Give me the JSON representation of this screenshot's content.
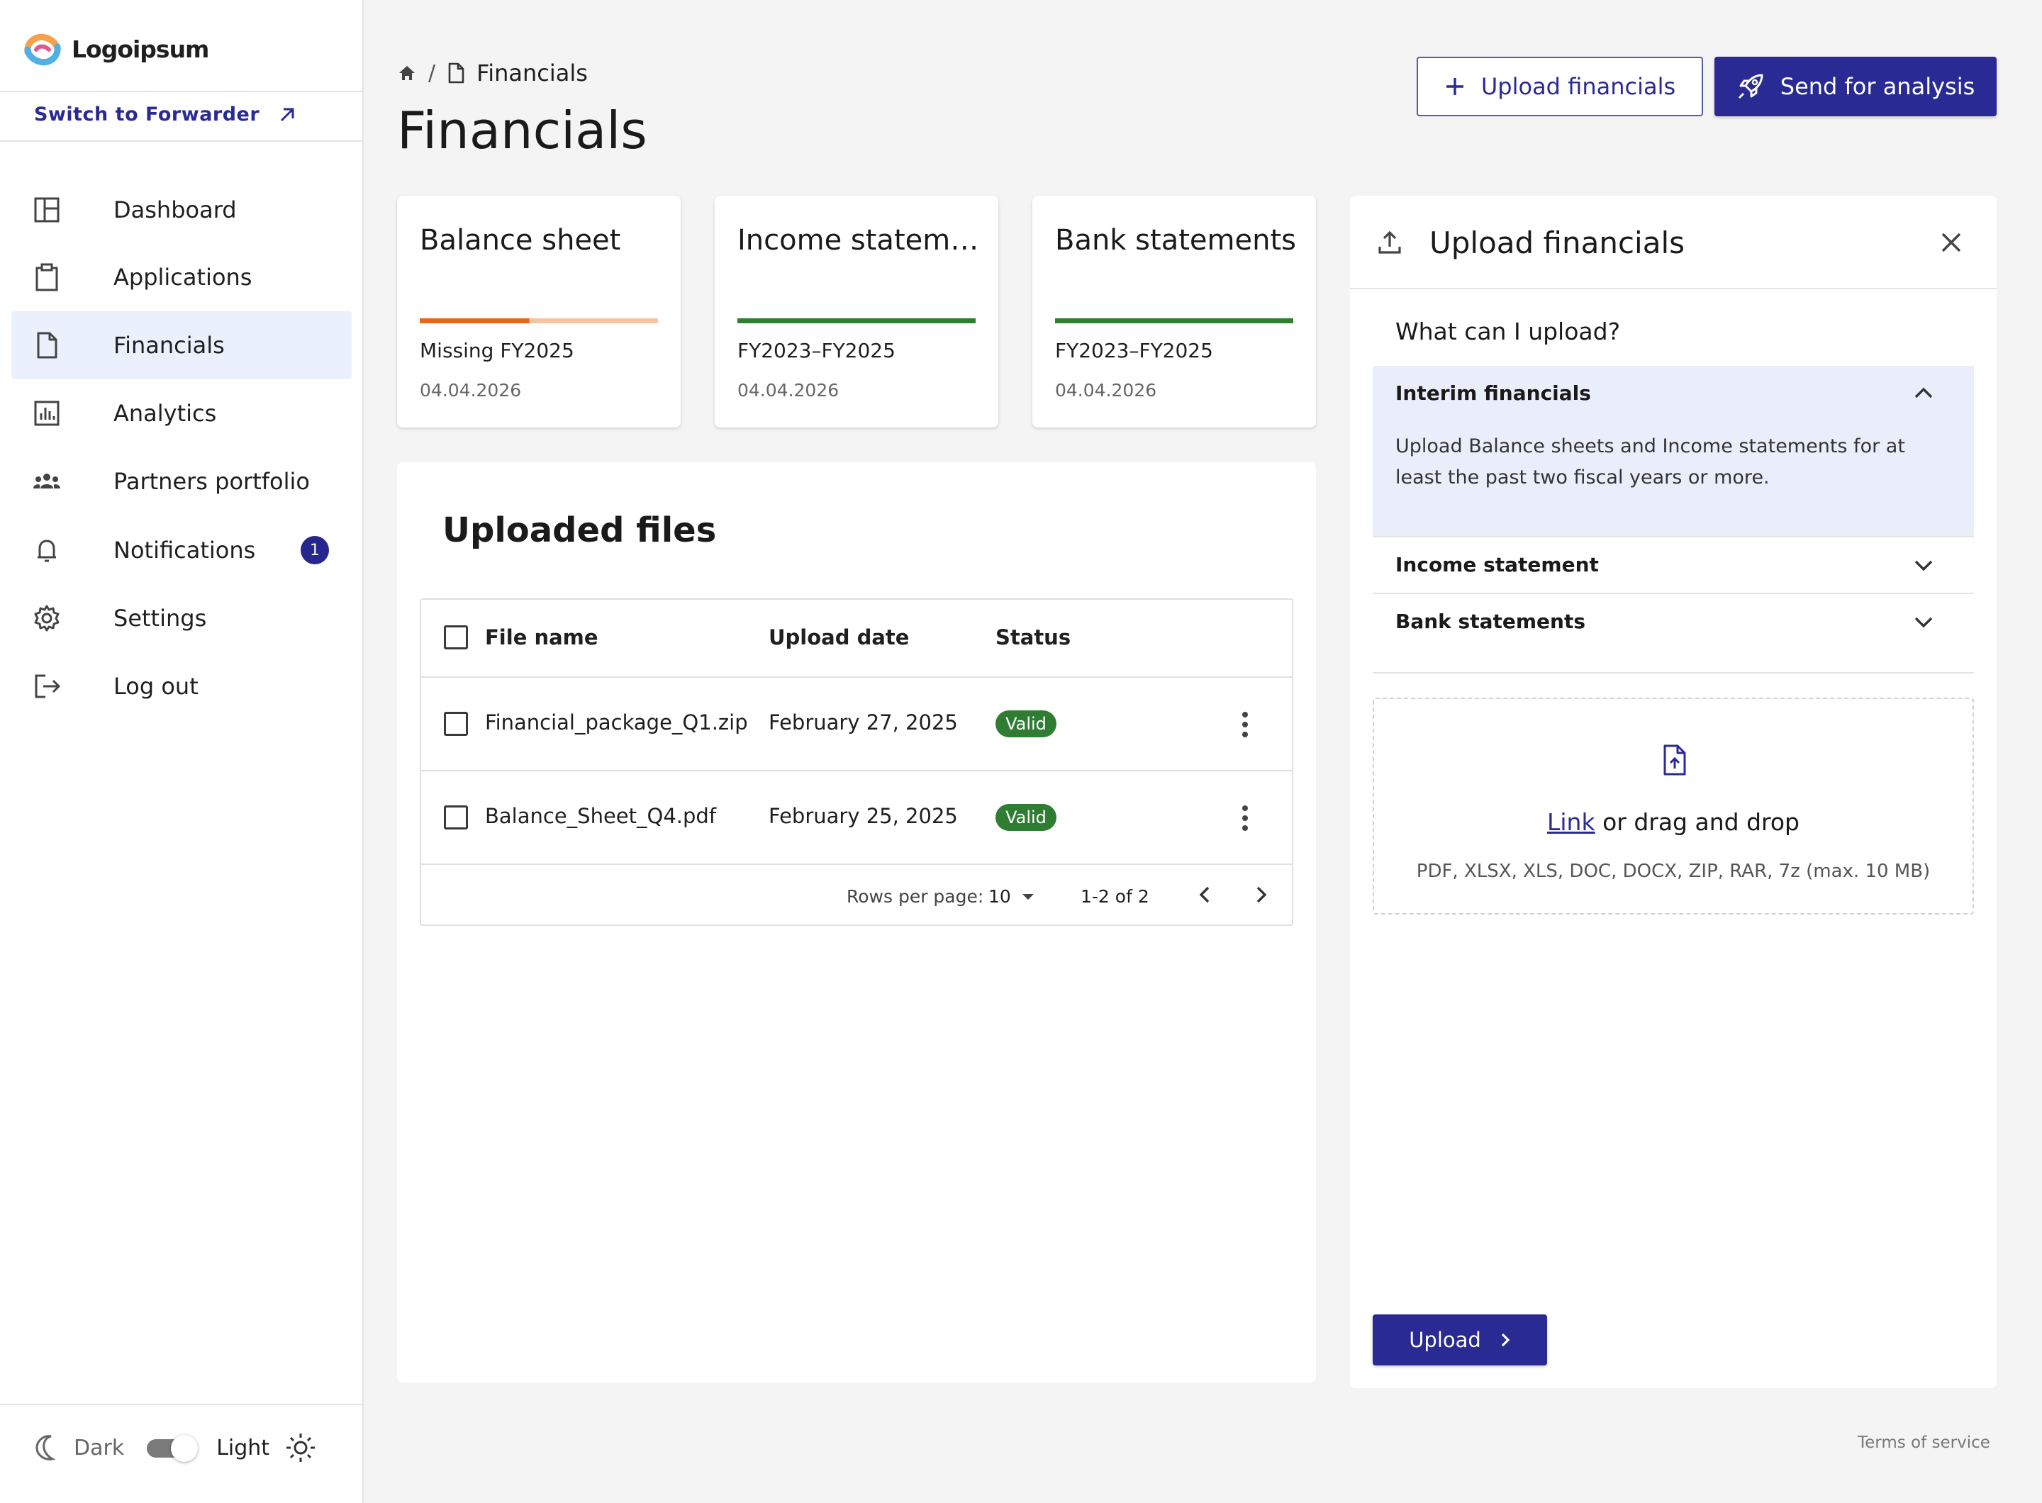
{
  "brand": {
    "name": "Logoipsum"
  },
  "sidebar": {
    "switch_label": "Switch to Forwarder",
    "items": [
      {
        "label": "Dashboard",
        "icon": "dashboard-icon"
      },
      {
        "label": "Applications",
        "icon": "clipboard-icon"
      },
      {
        "label": "Financials",
        "icon": "document-icon",
        "active": true
      },
      {
        "label": "Analytics",
        "icon": "bar-chart-icon"
      },
      {
        "label": "Partners portfolio",
        "icon": "people-icon"
      },
      {
        "label": "Notifications",
        "icon": "bell-icon",
        "badge": "1"
      },
      {
        "label": "Settings",
        "icon": "gear-icon"
      },
      {
        "label": "Log out",
        "icon": "logout-icon"
      }
    ],
    "theme": {
      "dark_label": "Dark",
      "light_label": "Light"
    }
  },
  "header": {
    "breadcrumb": [
      "Financials"
    ],
    "title": "Financials",
    "upload_button": "Upload financials",
    "send_button": "Send for analysis"
  },
  "cards": [
    {
      "title": "Balance sheet",
      "status": "Missing FY2025",
      "date": "04.04.2026",
      "progress": 0.46,
      "color": "#e8661c",
      "track": "#f5c4a4"
    },
    {
      "title": "Income statements",
      "status": "FY2023–FY2025",
      "date": "04.04.2026",
      "progress": 1.0,
      "color": "#2e7d32",
      "track": "#2e7d32"
    },
    {
      "title": "Bank statements",
      "status": "FY2023–FY2025",
      "date": "04.04.2026",
      "progress": 1.0,
      "color": "#2e7d32",
      "track": "#2e7d32"
    }
  ],
  "files": {
    "title": "Uploaded files",
    "columns": [
      "File name",
      "Upload date",
      "Status"
    ],
    "rows": [
      {
        "name": "Financial_package_Q1.zip",
        "date": "February 27, 2025",
        "status": "Valid"
      },
      {
        "name": "Balance_Sheet_Q4.pdf",
        "date": "February 25, 2025",
        "status": "Valid"
      }
    ],
    "pagination": {
      "rows_label": "Rows per page:",
      "rows_value": "10",
      "range": "1-2 of 2"
    }
  },
  "upload_panel": {
    "title": "Upload financials",
    "what_title": "What can I upload?",
    "accordion": [
      {
        "title": "Interim financials",
        "body": "Upload Balance sheets and Income statements for at least the past two fiscal years or more.",
        "open": true
      },
      {
        "title": "Income statement",
        "open": false
      },
      {
        "title": "Bank statements",
        "open": false
      }
    ],
    "dropzone": {
      "link": "Link",
      "text": " or drag and drop",
      "formats": "PDF, XLSX, XLS, DOC, DOCX, ZIP, RAR, 7z (max. 10 MB)"
    },
    "upload_button": "Upload"
  },
  "footer": {
    "terms": "Terms of service"
  },
  "colors": {
    "primary": "#2a2a95",
    "success": "#2e7d32",
    "warning": "#e8661c"
  }
}
